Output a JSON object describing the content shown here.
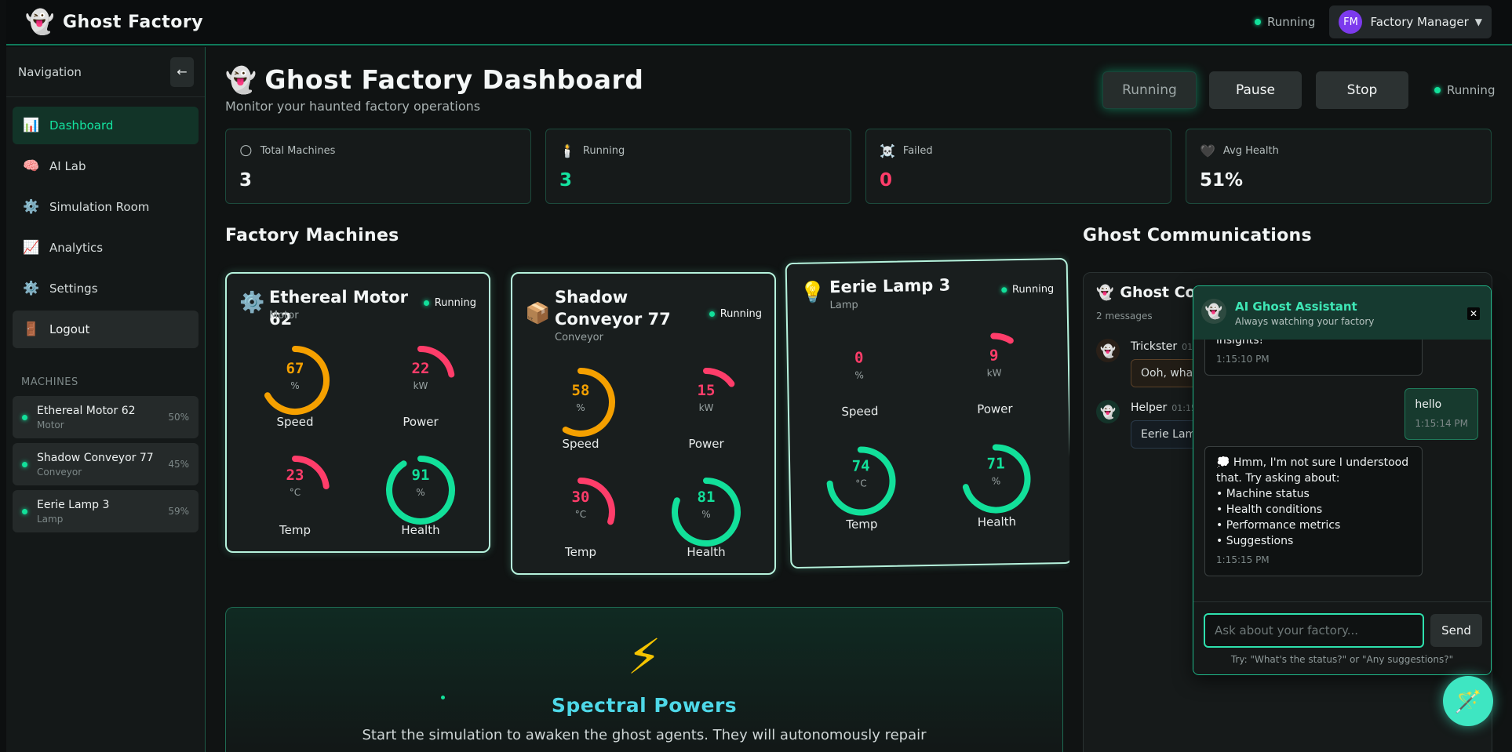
{
  "topbar": {
    "logo_icon": "ghost-icon",
    "brand": "Ghost Factory",
    "status": "Running",
    "user": {
      "initials": "FM",
      "name": "Factory Manager",
      "caret": "▼"
    }
  },
  "sidebar": {
    "title": "Navigation",
    "collapse": "←",
    "items": [
      {
        "icon": "📊",
        "label": "Dashboard",
        "active": true
      },
      {
        "icon": "🧠",
        "label": "AI Lab"
      },
      {
        "icon": "⚙️",
        "label": "Simulation Room"
      },
      {
        "icon": "📈",
        "label": "Analytics"
      },
      {
        "icon": "⚙️",
        "label": "Settings"
      },
      {
        "icon": "🚪",
        "label": "Logout"
      }
    ],
    "machines_heading": "MACHINES",
    "machines": [
      {
        "name": "Ethereal Motor 62",
        "type": "Motor",
        "pct": "50%"
      },
      {
        "name": "Shadow Conveyor 77",
        "type": "Conveyor",
        "pct": "45%"
      },
      {
        "name": "Eerie Lamp 3",
        "type": "Lamp",
        "pct": "59%"
      }
    ]
  },
  "header": {
    "icon": "👻",
    "title": "Ghost Factory Dashboard",
    "subtitle": "Monitor your haunted factory operations",
    "buttons": {
      "running": "Running",
      "pause": "Pause",
      "stop": "Stop"
    },
    "status": "Running"
  },
  "stats": [
    {
      "icon": "🌕",
      "label": "Total Machines",
      "value": "3",
      "color": "#f2f5f5"
    },
    {
      "icon": "🕯️",
      "label": "Running",
      "value": "3",
      "color": "#14e3a0"
    },
    {
      "icon": "☠️",
      "label": "Failed",
      "value": "0",
      "color": "#ff3d6a"
    },
    {
      "icon": "🖤",
      "label": "Avg Health",
      "value": "51%",
      "color": "#f2f5f5"
    }
  ],
  "machines_title": "Factory Machines",
  "machines": [
    {
      "icon": "⚙️",
      "name": "Ethereal Motor 62",
      "type": "Motor",
      "status": "Running",
      "gauges": {
        "speed": {
          "value": "67",
          "unit": "%",
          "label": "Speed",
          "fraction": 0.67,
          "color": "#f5a000"
        },
        "power": {
          "value": "22",
          "unit": "kW",
          "label": "Power",
          "fraction": 0.22,
          "color": "#ff3d6a"
        },
        "temp": {
          "value": "23",
          "unit": "°C",
          "label": "Temp",
          "fraction": 0.23,
          "color": "#ff3d6a"
        },
        "health": {
          "value": "91",
          "unit": "%",
          "label": "Health",
          "fraction": 0.91,
          "color": "#12e09a"
        }
      }
    },
    {
      "icon": "📦",
      "name": "Shadow Conveyor 77",
      "type": "Conveyor",
      "status": "Running",
      "gauges": {
        "speed": {
          "value": "58",
          "unit": "%",
          "label": "Speed",
          "fraction": 0.58,
          "color": "#f5a000"
        },
        "power": {
          "value": "15",
          "unit": "kW",
          "label": "Power",
          "fraction": 0.15,
          "color": "#ff3d6a"
        },
        "temp": {
          "value": "30",
          "unit": "°C",
          "label": "Temp",
          "fraction": 0.3,
          "color": "#ff3d6a"
        },
        "health": {
          "value": "81",
          "unit": "%",
          "label": "Health",
          "fraction": 0.81,
          "color": "#12e09a"
        }
      }
    },
    {
      "icon": "💡",
      "name": "Eerie Lamp 3",
      "type": "Lamp",
      "status": "Running",
      "gauges": {
        "speed": {
          "value": "0",
          "unit": "%",
          "label": "Speed",
          "fraction": 0.0,
          "color": "#ff3d6a"
        },
        "power": {
          "value": "9",
          "unit": "kW",
          "label": "Power",
          "fraction": 0.09,
          "color": "#ff3d6a"
        },
        "temp": {
          "value": "74",
          "unit": "°C",
          "label": "Temp",
          "fraction": 0.74,
          "color": "#12e09a"
        },
        "health": {
          "value": "71",
          "unit": "%",
          "label": "Health",
          "fraction": 0.71,
          "color": "#12e09a"
        }
      }
    }
  ],
  "powers": {
    "icon": "⚡",
    "title": "Spectral Powers",
    "desc": "Start the simulation to awaken the ghost agents. They will autonomously repair"
  },
  "comms": {
    "section_title": "Ghost Communications",
    "panel_title": "Ghost Co",
    "count": "2 messages",
    "messages": [
      {
        "sender": "Trickster",
        "time": "01",
        "text": "Ooh, what"
      },
      {
        "sender": "Helper",
        "time": "01:15",
        "text": "Eerie Lam"
      }
    ]
  },
  "assistant": {
    "title": "AI Ghost Assistant",
    "subtitle": "Always watching your factory",
    "close": "✕",
    "messages": {
      "bot1_text": "insights!",
      "bot1_time": "1:15:10 PM",
      "user_text": "hello",
      "user_time": "1:15:14 PM",
      "bot2_lines": [
        "💭 Hmm, I'm not sure I understood that. Try asking about:",
        "• Machine status",
        "• Health conditions",
        "• Performance metrics",
        "• Suggestions"
      ],
      "bot2_time": "1:15:15 PM"
    },
    "input_placeholder": "Ask about your factory...",
    "send": "Send",
    "hint": "Try: \"What's the status?\" or \"Any suggestions?\""
  },
  "fab_icon": "🪄"
}
